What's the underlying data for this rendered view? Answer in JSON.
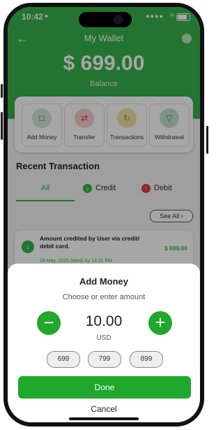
{
  "status": {
    "time": "10:42",
    "signal": "....",
    "wifi": "wifi"
  },
  "header": {
    "title": "My Wallet",
    "back_icon": "arrow-left-icon"
  },
  "wallet": {
    "amount": "$ 699.00",
    "amount_label": "Balance"
  },
  "actions": [
    {
      "label": "Add Money",
      "icon": "wallet-icon",
      "color": "#cfe9d6"
    },
    {
      "label": "Transfer",
      "icon": "transfer-icon",
      "color": "#f4cfd0"
    },
    {
      "label": "Transactions",
      "icon": "transactions-icon",
      "color": "#f1e4a6"
    },
    {
      "label": "Withdrawal",
      "icon": "withdrawal-icon",
      "color": "#bfe3cf"
    }
  ],
  "recent": {
    "title": "Recent Transaction",
    "tabs": [
      {
        "label": "All"
      },
      {
        "label": "Credit",
        "icon": "arrow-down-icon",
        "color": "#37b34a"
      },
      {
        "label": "Debit",
        "icon": "arrow-up-icon",
        "color": "#d93f3f"
      }
    ],
    "see_all": "See All",
    "transactions": [
      {
        "text": "Amount credited by User via credit/ debit card.",
        "date": "28 May, 2025 (Wed) by 12:31 PM",
        "amount": "$ 699.00"
      }
    ]
  },
  "sheet": {
    "title": "Add Money",
    "subtitle": "Choose or enter amount",
    "value": "10.00",
    "currency": "USD",
    "presets": [
      "699",
      "799",
      "899"
    ],
    "done_label": "Done",
    "cancel_label": "Cancel"
  },
  "colors": {
    "brand": "#37b34a",
    "button": "#1fa82b",
    "debit": "#d93f3f"
  }
}
